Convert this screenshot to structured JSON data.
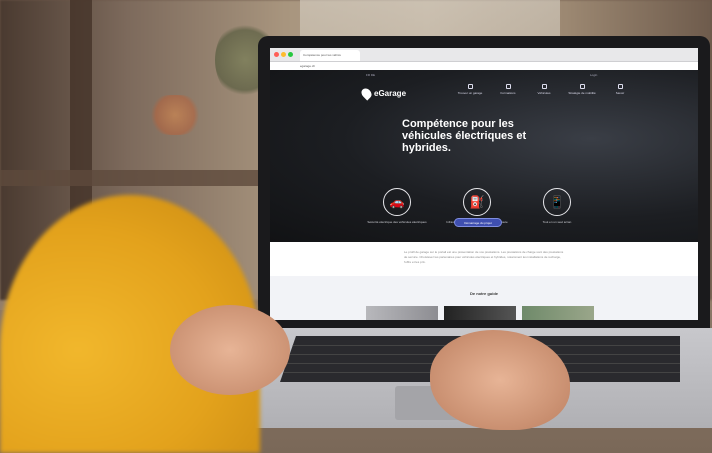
{
  "site": {
    "tab_title": "Compétence pour les véhicu",
    "url": "egarage.ch",
    "logo_text": "eGarage",
    "topbar_left": "FR  DE",
    "topbar_right": "Login",
    "nav": [
      {
        "label": "Trouver un garage"
      },
      {
        "label": "Formations"
      },
      {
        "label": "Véhicules"
      },
      {
        "label": "Stratégie de mobilité"
      },
      {
        "label": "Savoir"
      }
    ],
    "headline": "Compétence pour les véhicules électriques et hybrides.",
    "features": [
      {
        "icon": "car-icon",
        "glyph": "🚗",
        "label": "Sécurité électrique des véhicules électriques"
      },
      {
        "icon": "charging-station-icon",
        "glyph": "⛽",
        "label": "Infrastructure de charge chez vous et en route"
      },
      {
        "icon": "smartphone-icon",
        "glyph": "📱",
        "label": "Tout en un seul écran"
      }
    ],
    "cta_label": "Démarrage du projet",
    "paragraph": "Le profil de garage sur le portail est une présentation de vos prestations. Les prestations de charge sont des prestations de service. Choisissez les partenaires pour véhicules électriques et hybrides, notamment les installations de recharge, l'offre et les prix.",
    "guide_title": "De notre guide"
  },
  "colors": {
    "hero_bg": "#1c1e22",
    "cta": "#3f4fb0",
    "shirt": "#e3a21c"
  }
}
